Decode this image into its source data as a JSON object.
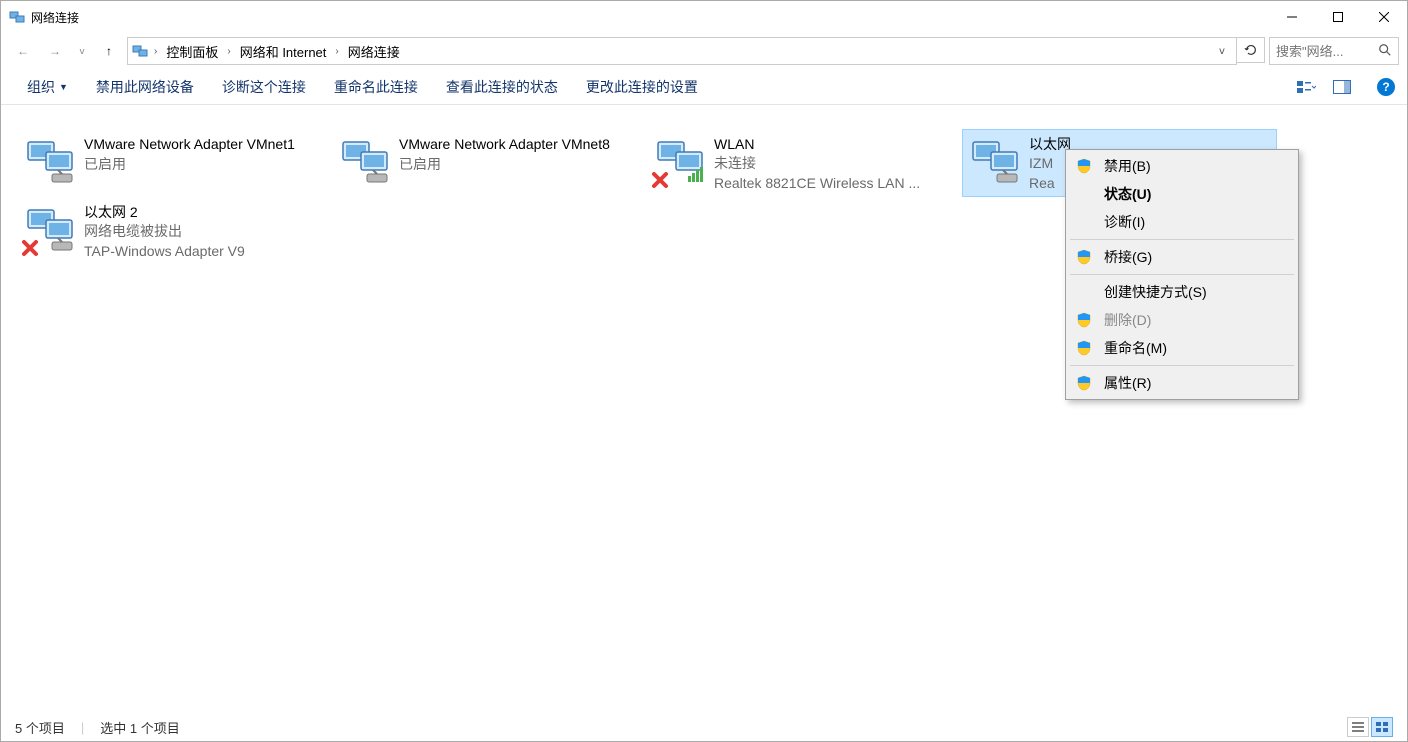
{
  "window": {
    "title": "网络连接"
  },
  "breadcrumbs": {
    "root_sep": "›",
    "items": [
      "控制面板",
      "网络和 Internet",
      "网络连接"
    ]
  },
  "search": {
    "placeholder": "搜索\"网络...",
    "icon_glyph": "🔍"
  },
  "toolbar": {
    "organize": "组织",
    "disable": "禁用此网络设备",
    "diagnose": "诊断这个连接",
    "rename": "重命名此连接",
    "status": "查看此连接的状态",
    "settings": "更改此连接的设置"
  },
  "connections": [
    {
      "name": "VMware Network Adapter VMnet1",
      "status": "已启用",
      "device": "",
      "icon": "net",
      "overlay": ""
    },
    {
      "name": "VMware Network Adapter VMnet8",
      "status": "已启用",
      "device": "",
      "icon": "net",
      "overlay": ""
    },
    {
      "name": "WLAN",
      "status": "未连接",
      "device": "Realtek 8821CE Wireless LAN ...",
      "icon": "wlan",
      "overlay": "x"
    },
    {
      "name": "以太网",
      "status": "IZM",
      "device": "Rea",
      "icon": "net",
      "overlay": "",
      "selected": true
    },
    {
      "name": "以太网 2",
      "status": "网络电缆被拔出",
      "device": "TAP-Windows Adapter V9",
      "icon": "net",
      "overlay": "x"
    }
  ],
  "context_menu": {
    "items": [
      {
        "label": "禁用(B)",
        "shield": true
      },
      {
        "label": "状态(U)",
        "bold": true
      },
      {
        "label": "诊断(I)"
      },
      {
        "sep": true
      },
      {
        "label": "桥接(G)",
        "shield": true
      },
      {
        "sep": true
      },
      {
        "label": "创建快捷方式(S)"
      },
      {
        "label": "删除(D)",
        "shield": true,
        "disabled": true
      },
      {
        "label": "重命名(M)",
        "shield": true
      },
      {
        "sep": true
      },
      {
        "label": "属性(R)",
        "shield": true
      }
    ]
  },
  "statusbar": {
    "count": "5 个项目",
    "selection": "选中 1 个项目"
  }
}
